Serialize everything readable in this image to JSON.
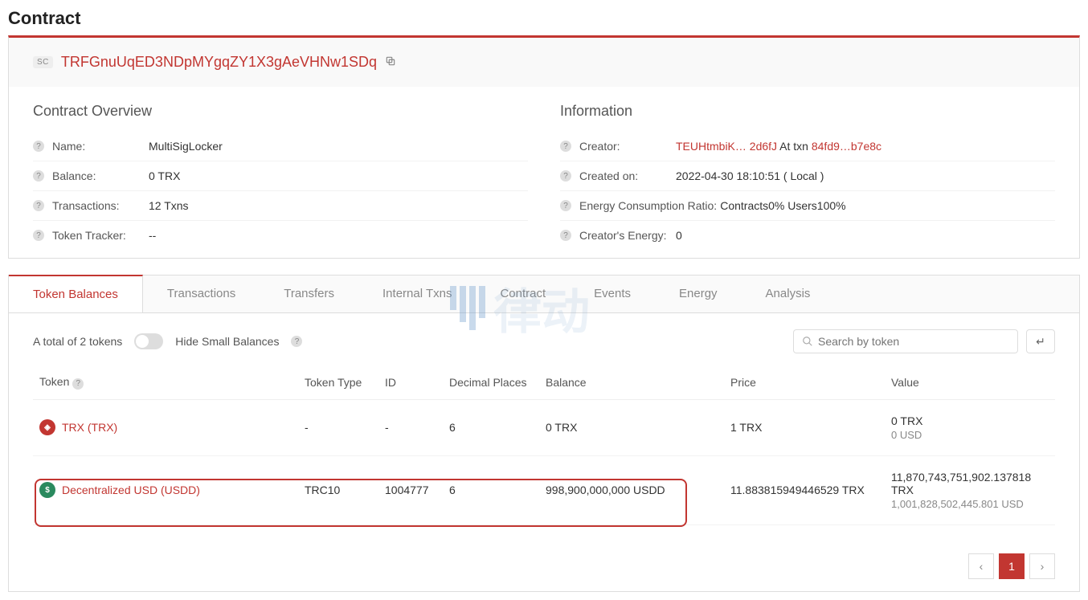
{
  "page_title": "Contract",
  "sc_badge": "SC",
  "address": "TRFGnuUqED3NDpMYgqZY1X3gAeVHNw1SDq",
  "overview": {
    "heading": "Contract Overview",
    "name_label": "Name:",
    "name_value": "MultiSigLocker",
    "balance_label": "Balance:",
    "balance_value": "0  TRX",
    "txns_label": "Transactions:",
    "txns_value": "12   Txns",
    "tracker_label": "Token Tracker:",
    "tracker_value": "--"
  },
  "information": {
    "heading": "Information",
    "creator_label": "Creator:",
    "creator_part1": "TEUHtmbiK…  2d6fJ",
    "creator_txn_prefix": " At txn ",
    "creator_txn": "84fd9…b7e8c",
    "created_label": "Created on:",
    "created_value": "2022-04-30 18:10:51 ( Local )",
    "energy_label": "Energy Consumption Ratio:",
    "energy_value": "Contracts0%  Users100%",
    "creator_energy_label": "Creator's Energy:",
    "creator_energy_value": "0"
  },
  "tabs": [
    "Token Balances",
    "Transactions",
    "Transfers",
    "Internal Txns",
    "Contract",
    "Events",
    "Energy",
    "Analysis"
  ],
  "toolbar": {
    "total_text": "A total of 2 tokens",
    "hide_label": "Hide Small Balances",
    "search_placeholder": "Search by token"
  },
  "table": {
    "headers": [
      "Token",
      "Token Type",
      "ID",
      "Decimal Places",
      "Balance",
      "Price",
      "Value"
    ],
    "rows": [
      {
        "token": "TRX (TRX)",
        "icon_color": "trx",
        "type": "-",
        "id": "-",
        "decimals": "6",
        "balance": "0 TRX",
        "price": "1 TRX",
        "value1": "0 TRX",
        "value2": "0 USD",
        "highlighted": false
      },
      {
        "token": "Decentralized USD (USDD)",
        "icon_color": "usdd",
        "type": "TRC10",
        "id": "1004777",
        "decimals": "6",
        "balance": "998,900,000,000 USDD",
        "price": "11.883815949446529 TRX",
        "value1": "11,870,743,751,902.137818 TRX",
        "value2": "1,001,828,502,445.801 USD",
        "highlighted": true
      }
    ]
  },
  "pagination": {
    "current": "1"
  }
}
